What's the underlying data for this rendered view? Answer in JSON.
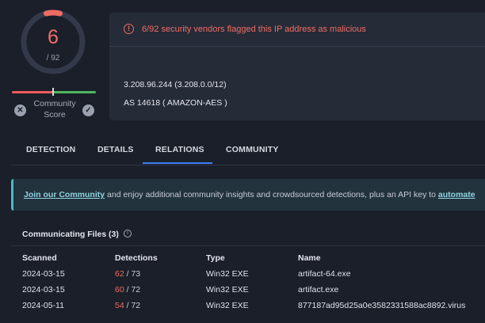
{
  "score": {
    "malicious": "6",
    "total_label": "/ 92",
    "community_label_1": "Community",
    "community_label_2": "Score",
    "vote_down_icon": "x-icon",
    "vote_up_icon": "check-icon",
    "accent_color": "#ef6c62"
  },
  "summary": {
    "alert_text": "6/92 security vendors flagged this IP address as malicious",
    "ip_line": "3.208.96.244  (3.208.0.0/12)",
    "as_line": "AS 14618  ( AMAZON-AES )"
  },
  "tabs": [
    {
      "label": "DETECTION"
    },
    {
      "label": "DETAILS"
    },
    {
      "label": "RELATIONS",
      "active": true
    },
    {
      "label": "COMMUNITY"
    }
  ],
  "banner": {
    "link_text": "Join our Community",
    "text": " and enjoy additional community insights and crowdsourced detections, plus an API key to ",
    "link2_text": "automate"
  },
  "files": {
    "title": "Communicating Files",
    "count": "(3)",
    "columns": [
      "Scanned",
      "Detections",
      "Type",
      "Name"
    ],
    "rows": [
      {
        "scanned": "2024-03-15",
        "hits": "62",
        "total": " / 73",
        "type": "Win32 EXE",
        "name": "artifact-64.exe"
      },
      {
        "scanned": "2024-03-15",
        "hits": "60",
        "total": " / 72",
        "type": "Win32 EXE",
        "name": "artifact.exe"
      },
      {
        "scanned": "2024-05-11",
        "hits": "54",
        "total": " / 72",
        "type": "Win32 EXE",
        "name": "877187ad95d25a0e3582331588ac8892.virus"
      }
    ]
  }
}
